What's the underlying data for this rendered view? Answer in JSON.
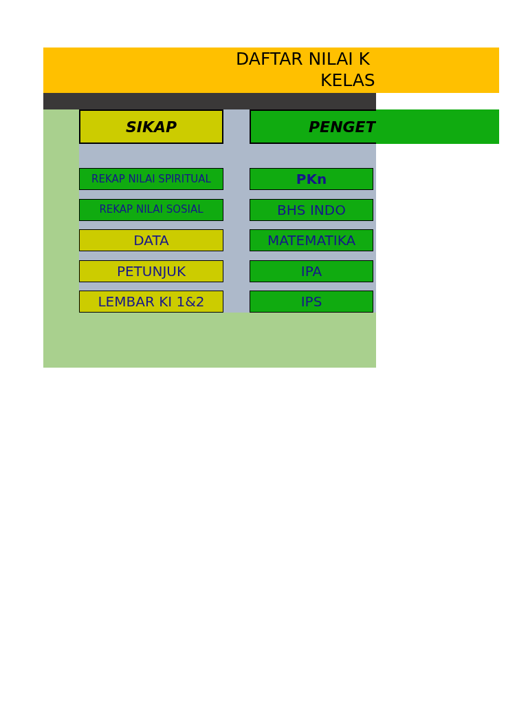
{
  "title": {
    "lines": [
      "DAFTAR NILAI K",
      "KELAS"
    ]
  },
  "columns": [
    {
      "heading": "SIKAP",
      "color": "#cccc00",
      "buttons": [
        {
          "label": "REKAP NILAI SPIRITUAL",
          "kind": "small",
          "color": "#10ab10"
        },
        {
          "label": "REKAP NILAI SOSIAL",
          "kind": "small",
          "color": "#10ab10"
        },
        {
          "label": "DATA",
          "kind": "regular",
          "color": "#cccc00"
        },
        {
          "label": "PETUNJUK",
          "kind": "regular",
          "color": "#cccc00"
        },
        {
          "label": "LEMBAR KI 1&2",
          "kind": "regular",
          "color": "#cccc00"
        }
      ]
    },
    {
      "heading": "PENGET",
      "color": "#10ab10",
      "buttons": [
        {
          "label": "PKn",
          "kind": "bold",
          "color": "#10ab10"
        },
        {
          "label": "BHS INDO",
          "kind": "regular",
          "color": "#10ab10"
        },
        {
          "label": "MATEMATIKA",
          "kind": "regular",
          "color": "#10ab10"
        },
        {
          "label": "IPA",
          "kind": "regular",
          "color": "#10ab10"
        },
        {
          "label": "IPS",
          "kind": "regular",
          "color": "#10ab10"
        }
      ]
    }
  ]
}
